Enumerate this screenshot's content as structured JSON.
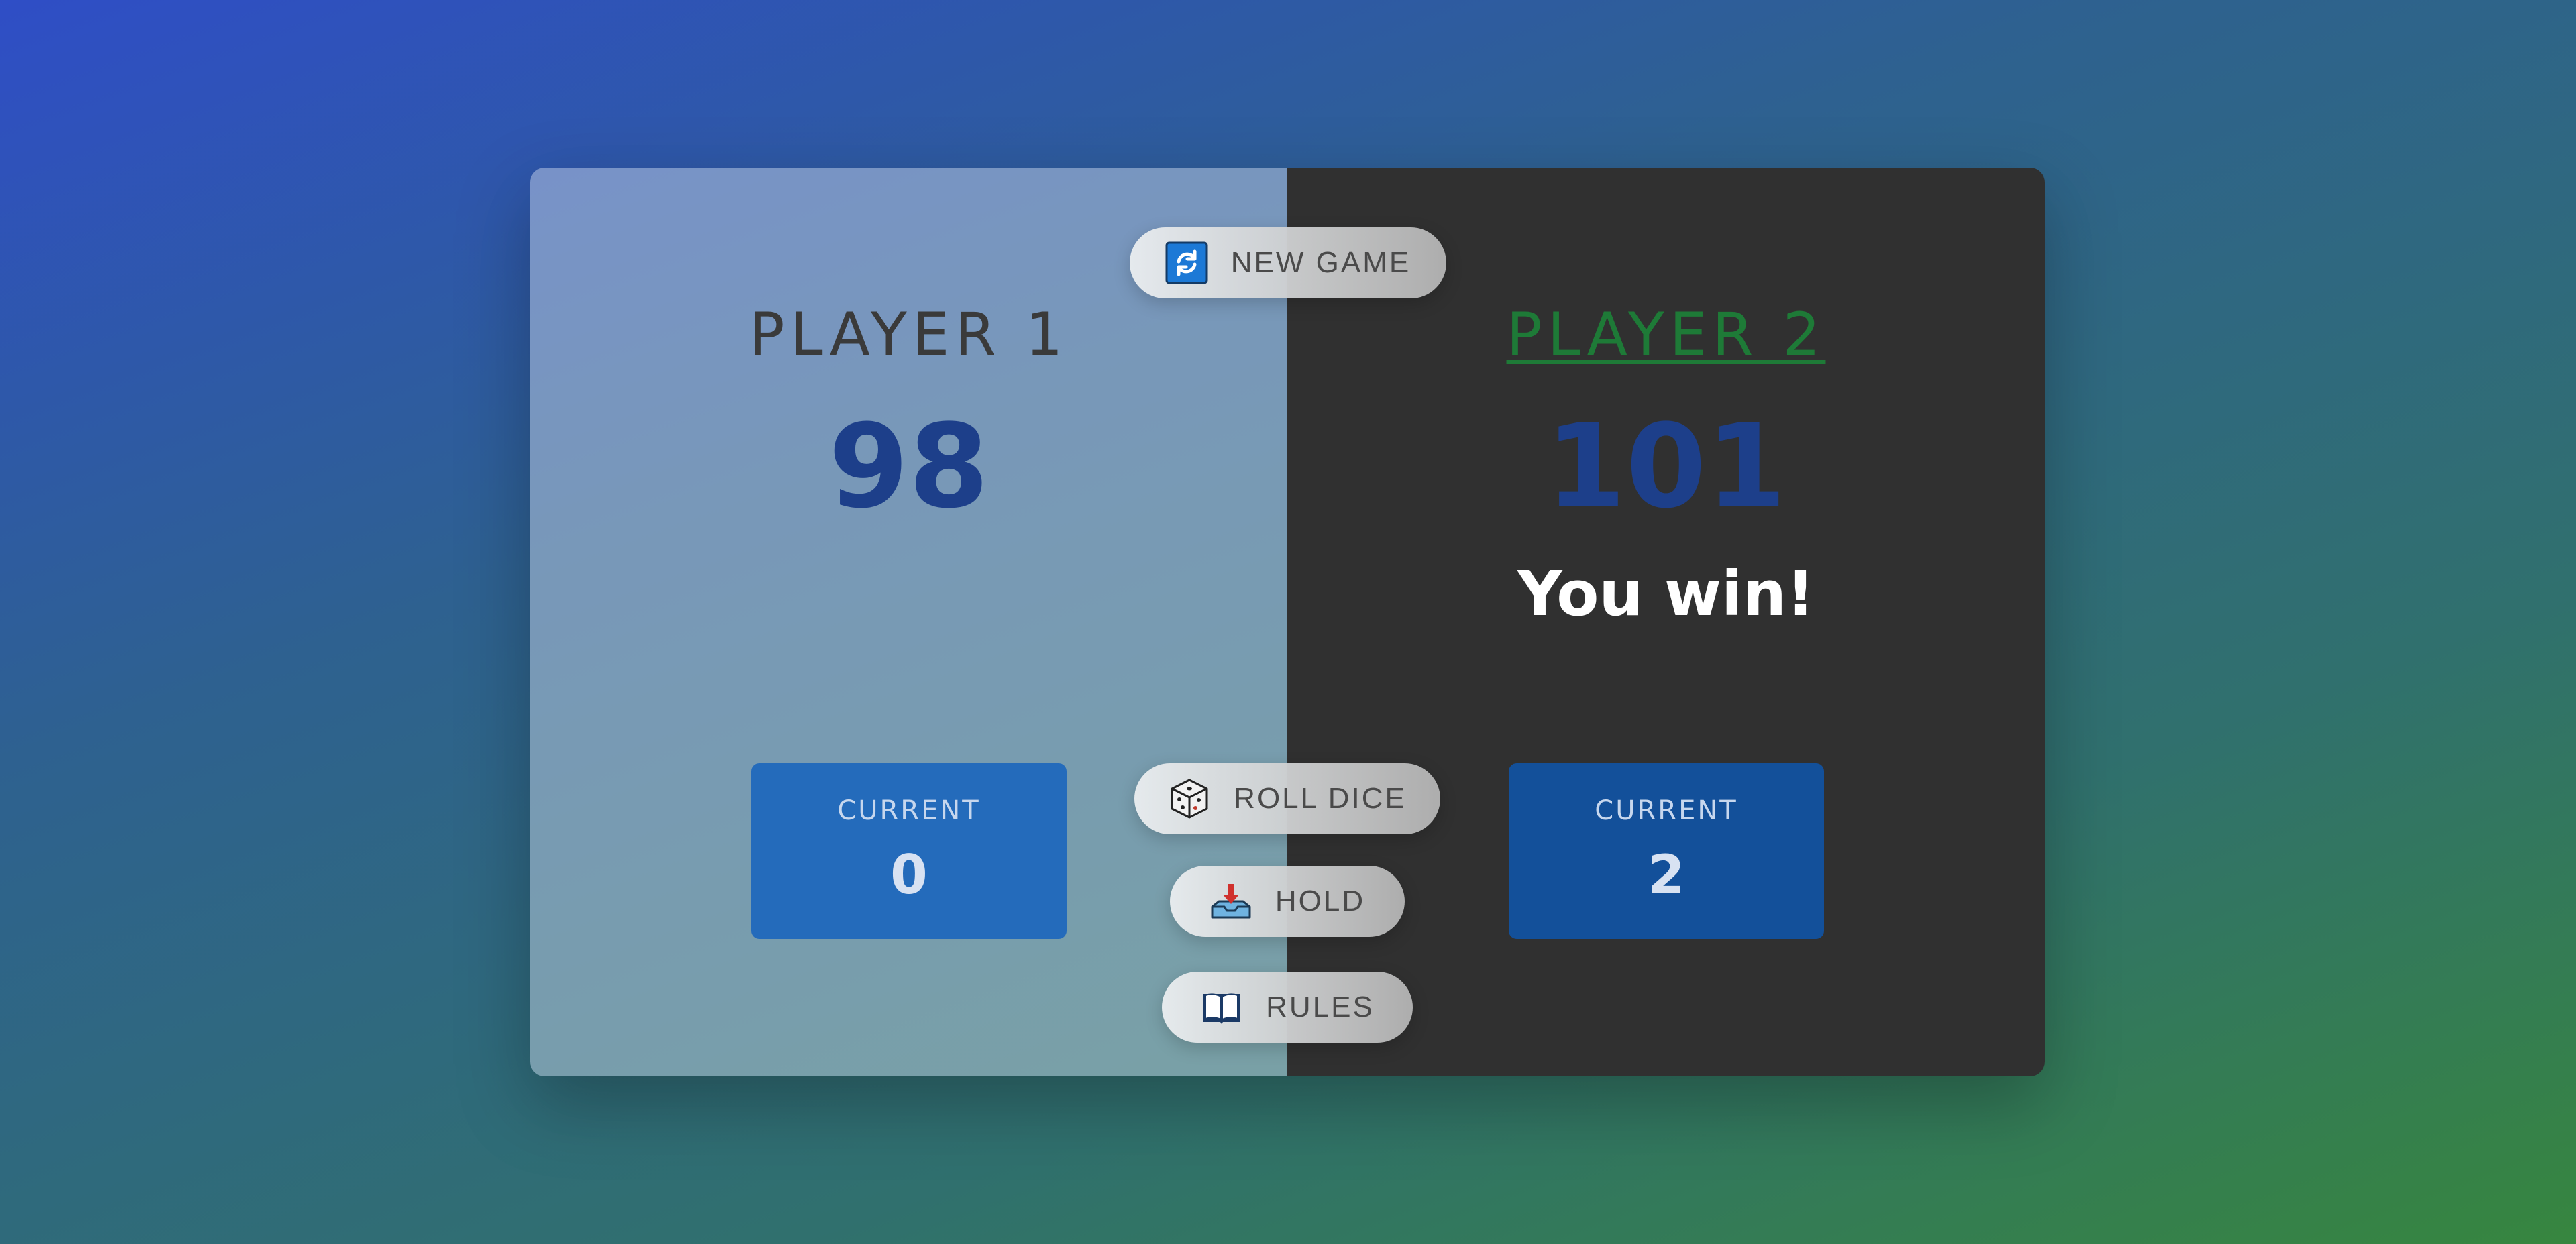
{
  "players": [
    {
      "name": "PLAYER 1",
      "score": "98",
      "current_label": "CURRENT",
      "current_value": "0",
      "message": ""
    },
    {
      "name": "PLAYER 2",
      "score": "101",
      "current_label": "CURRENT",
      "current_value": "2",
      "message": "You win!"
    }
  ],
  "buttons": {
    "new_game": {
      "label": "NEW GAME",
      "icon": "refresh-icon"
    },
    "roll_dice": {
      "label": "ROLL DICE",
      "icon": "dice-icon"
    },
    "hold": {
      "label": "HOLD",
      "icon": "inbox-tray-icon"
    },
    "rules": {
      "label": "RULES",
      "icon": "open-book-icon"
    }
  },
  "colors": {
    "winner_name": "#1e7a37",
    "score": "#1d3f8a",
    "active_panel": "#303030"
  }
}
